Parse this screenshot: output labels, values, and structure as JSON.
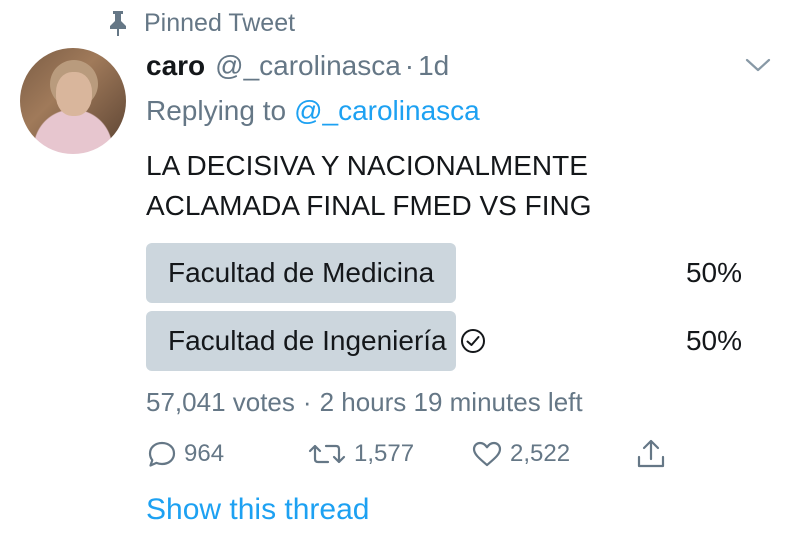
{
  "pinned": {
    "label": "Pinned Tweet",
    "icon": "pin-icon"
  },
  "author": {
    "name": "caro",
    "handle": "@_carolinasca",
    "separator": "·",
    "time": "1d"
  },
  "reply": {
    "prefix": "Replying to",
    "to": "@_carolinasca"
  },
  "tweet": {
    "line1": "LA DECISIVA Y NACIONALMENTE",
    "line2": "ACLAMADA FINAL FMED VS FING"
  },
  "poll": {
    "options": [
      {
        "label": "Facultad de Medicina",
        "percent": "50%",
        "fraction": 0.5,
        "selected": false
      },
      {
        "label": "Facultad de Ingeniería",
        "percent": "50%",
        "fraction": 0.5,
        "selected": true
      }
    ],
    "votes": "57,041 votes",
    "separator": "·",
    "time_left": "2 hours 19 minutes left"
  },
  "actions": {
    "replies": "964",
    "retweets": "1,577",
    "likes": "2,522"
  },
  "show_thread": "Show this thread",
  "colors": {
    "link": "#1da1f2",
    "muted": "#657786",
    "poll_bar": "#ccd6dd",
    "text": "#14171a"
  }
}
